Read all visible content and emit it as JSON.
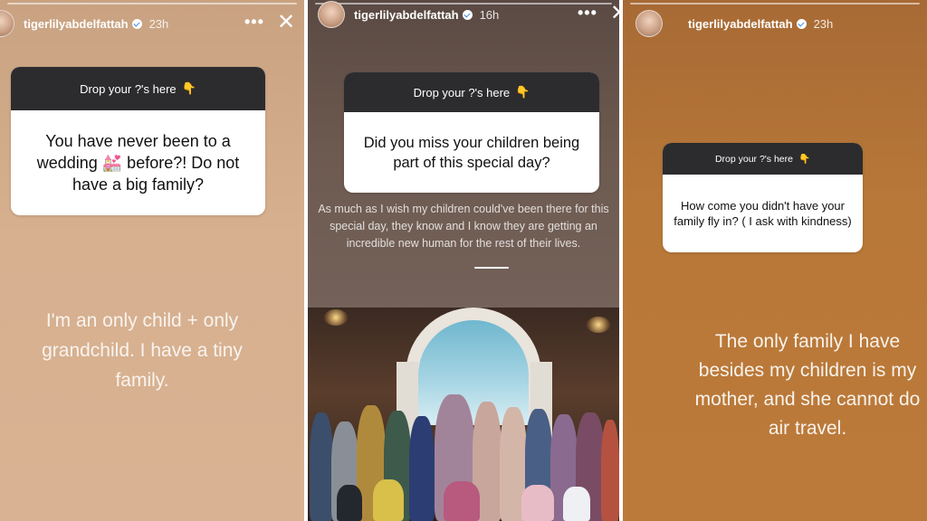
{
  "stories": [
    {
      "username": "tigerlilyabdelfattah",
      "time": "23h",
      "more_label": "•••",
      "close_label": "✕",
      "question_header": "Drop your ?'s here",
      "question_header_icon": "pointing-hand-emoji",
      "question": "You have never been to a wedding 💒 before?! Do not have a big family?",
      "answer": "I'm an only child + only grandchild. I have a tiny family."
    },
    {
      "username": "tigerlilyabdelfattah",
      "time": "16h",
      "more_label": "•••",
      "close_label": "✕",
      "question_header": "Drop your ?'s here",
      "question_header_icon": "pointing-hand-emoji",
      "question": "Did you miss your children being part of this special day?",
      "answer": "As much as I wish my children could've been there for this special day, they know and I know they are getting an incredible new human for the rest of their lives."
    },
    {
      "username": "tigerlilyabdelfattah",
      "time": "23h",
      "question_header": "Drop your ?'s here",
      "question_header_icon": "pointing-hand-emoji",
      "question": "How come you didn't have your family fly in? ( I ask with kindness)",
      "answer": "The only family I have besides my children is my mother, and she cannot do air travel."
    }
  ],
  "hand_glyph": "👇",
  "colors": {
    "panel1_bg": "#d6b08f",
    "panel2_bg": "#6d5a50",
    "panel3_bg": "#b87838",
    "question_header_bg": "#2c2c2e",
    "verified_badge": "#3b82f6"
  }
}
